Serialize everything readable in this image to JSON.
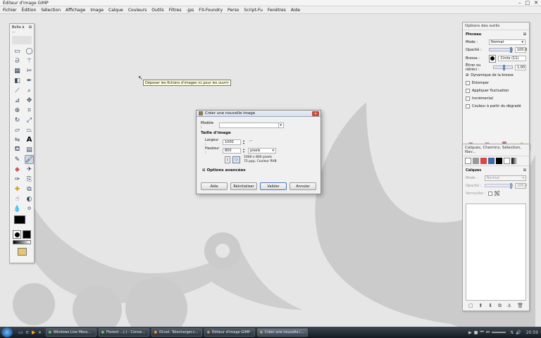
{
  "window": {
    "title": "Éditeur d'image GIMP"
  },
  "menubar": {
    "items": [
      "Fichier",
      "Édition",
      "Sélection",
      "Affichage",
      "Image",
      "Calque",
      "Couleurs",
      "Outils",
      "Filtres",
      "-jps",
      "FX-Foundry",
      "Perso",
      "Script-Fu",
      "Fenêtres",
      "Aide"
    ]
  },
  "tooltip": {
    "text": "Déposer les fichiers d'images ici pour les ouvrir"
  },
  "toolbox": {
    "title": "Boîte à ...",
    "tools": [
      "rect-select-icon",
      "ellipse-select-icon",
      "lasso-icon",
      "magic-wand-icon",
      "color-select-icon",
      "scissors-icon",
      "foreground-select-icon",
      "paths-icon",
      "color-picker-icon",
      "zoom-icon",
      "measure-icon",
      "move-icon",
      "align-icon",
      "crop-icon",
      "rotate-icon",
      "scale-icon",
      "shear-icon",
      "perspective-icon",
      "flip-icon",
      "text-icon",
      "bucket-fill-icon",
      "blend-icon",
      "pencil-icon",
      "paintbrush-icon",
      "eraser-icon",
      "airbrush-icon",
      "ink-icon",
      "clone-icon",
      "heal-icon",
      "perspective-clone-icon",
      "smudge-icon",
      "dodge-burn-icon",
      "blur-icon",
      "convolve-icon"
    ]
  },
  "tool_options": {
    "title": "Options des outils",
    "section": "Pinceau",
    "mode_label": "Mode :",
    "mode_value": "Normal",
    "opacity_label": "Opacité :",
    "opacity_value": "100,0",
    "brush_label": "Brosse :",
    "brush_value": "Circle (11)",
    "scale_label": "Étirer ou rétréci :",
    "scale_value": "1,00",
    "dynamics_label": "Dynamique de la brosse",
    "checkboxes": [
      "Estomper",
      "Appliquer fluctuation",
      "Incrémental",
      "Couleur à partir du dégradé"
    ]
  },
  "layers": {
    "title": "Calques, Chemins, Sélection, Nav...",
    "section": "Calques",
    "mode_label": "Mode :",
    "mode_value": "Normal",
    "opacity_label": "Opacité :",
    "opacity_value": "100,0",
    "lock_label": "Verrouiller :"
  },
  "dialog": {
    "title": "Créer une nouvelle image",
    "template_label": "Modèle :",
    "template_value": "",
    "size_header": "Taille d'image",
    "width_label": "Largeur :",
    "width_value": "1000",
    "height_label": "Hauteur :",
    "height_value": "800",
    "unit_value": "pixels",
    "info_line1": "1000 x 800 pixels",
    "info_line2": "72 ppp, Couleur RVB",
    "advanced_label": "Options avancées",
    "buttons": {
      "help": "Aide",
      "reset": "Réinitialiser",
      "ok": "Valider",
      "cancel": "Annuler"
    }
  },
  "taskbar": {
    "tasks": [
      "Windows Live Mess...",
      "Florent ...(-) - Conve...",
      "01net. Telecharger.c...",
      "Éditeur d'image GIMP",
      "Créer une nouvelle i..."
    ],
    "clock": "20:59"
  }
}
